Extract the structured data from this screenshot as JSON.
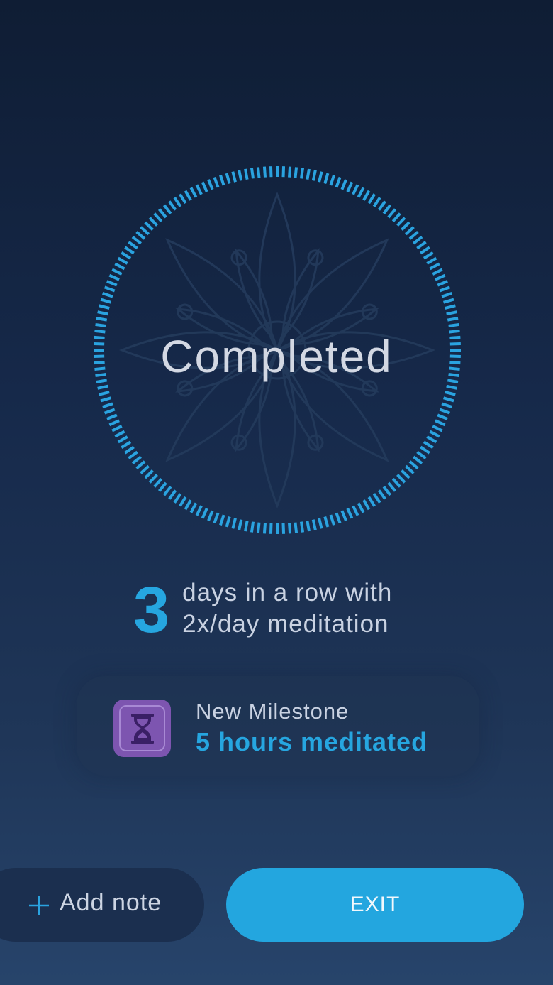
{
  "status": {
    "title": "Completed"
  },
  "streak": {
    "count": "3",
    "line1": "days in a row with",
    "line2": "2x/day meditation"
  },
  "milestone": {
    "title": "New Milestone",
    "value": "5 hours meditated",
    "icon": "hourglass-icon"
  },
  "actions": {
    "add_note_label": "Add note",
    "exit_label": "EXIT"
  },
  "colors": {
    "accent": "#26a6e0",
    "milestone_badge": "#7d55b0",
    "background_top": "#0f1d34",
    "background_bottom": "#27446b"
  }
}
